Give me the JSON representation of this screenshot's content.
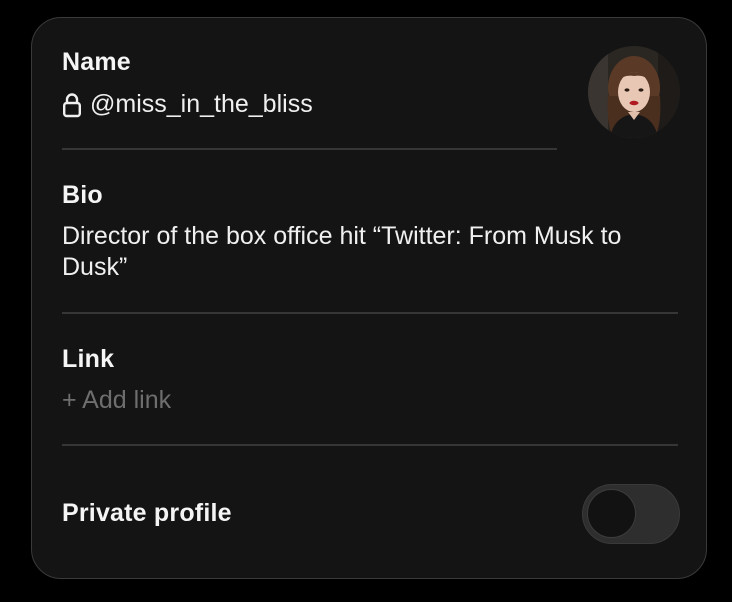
{
  "name_section": {
    "label": "Name",
    "handle": "@miss_in_the_bliss",
    "lock_icon": "lock-icon",
    "avatar_icon": "profile-photo"
  },
  "bio_section": {
    "label": "Bio",
    "text": "Director of the box office hit “Twitter: From Musk to Dusk”"
  },
  "link_section": {
    "label": "Link",
    "placeholder": "+ Add link"
  },
  "private_section": {
    "label": "Private profile",
    "toggle_on": false
  },
  "colors": {
    "background": "#000000",
    "card": "#141414",
    "text": "#f5f5f5",
    "muted": "#6e6e6e",
    "divider": "#363636"
  }
}
